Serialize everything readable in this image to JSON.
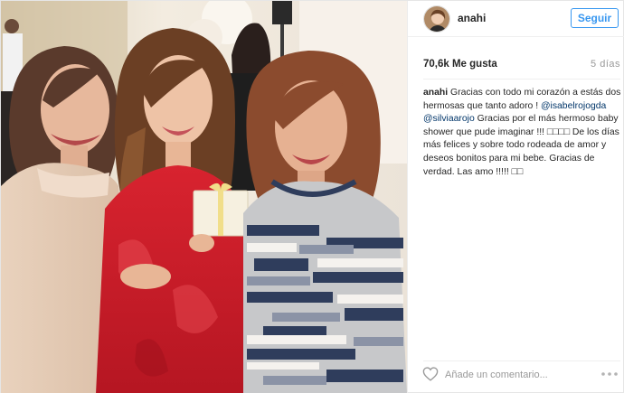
{
  "post": {
    "username": "anahi",
    "follow_label": "Seguir",
    "likes": "70,6k Me gusta",
    "time_ago": "5 días",
    "caption": {
      "username": "anahi",
      "text_1": "Gracias con todo mi corazón a estás dos hermosas que tanto adoro !",
      "mention_1": "@isabelrojogda",
      "mention_2": "@silviaarojo",
      "text_2": "Gracias por el más hermoso baby shower que pude imaginar !!! ",
      "emoji_1": "□□□□",
      "text_3": " De los días más felices y sobre todo rodeada de amor y deseos bonitos para mi bebe. Gracias de verdad. Las amo !!!!! ",
      "emoji_2": "□□"
    },
    "comment_placeholder": "Añade un comentario...",
    "icons": {
      "like": "heart-outline-icon",
      "options": "more-options-icon"
    },
    "colors": {
      "accent": "#3897f0",
      "mention": "#003569",
      "muted": "#999999"
    }
  }
}
